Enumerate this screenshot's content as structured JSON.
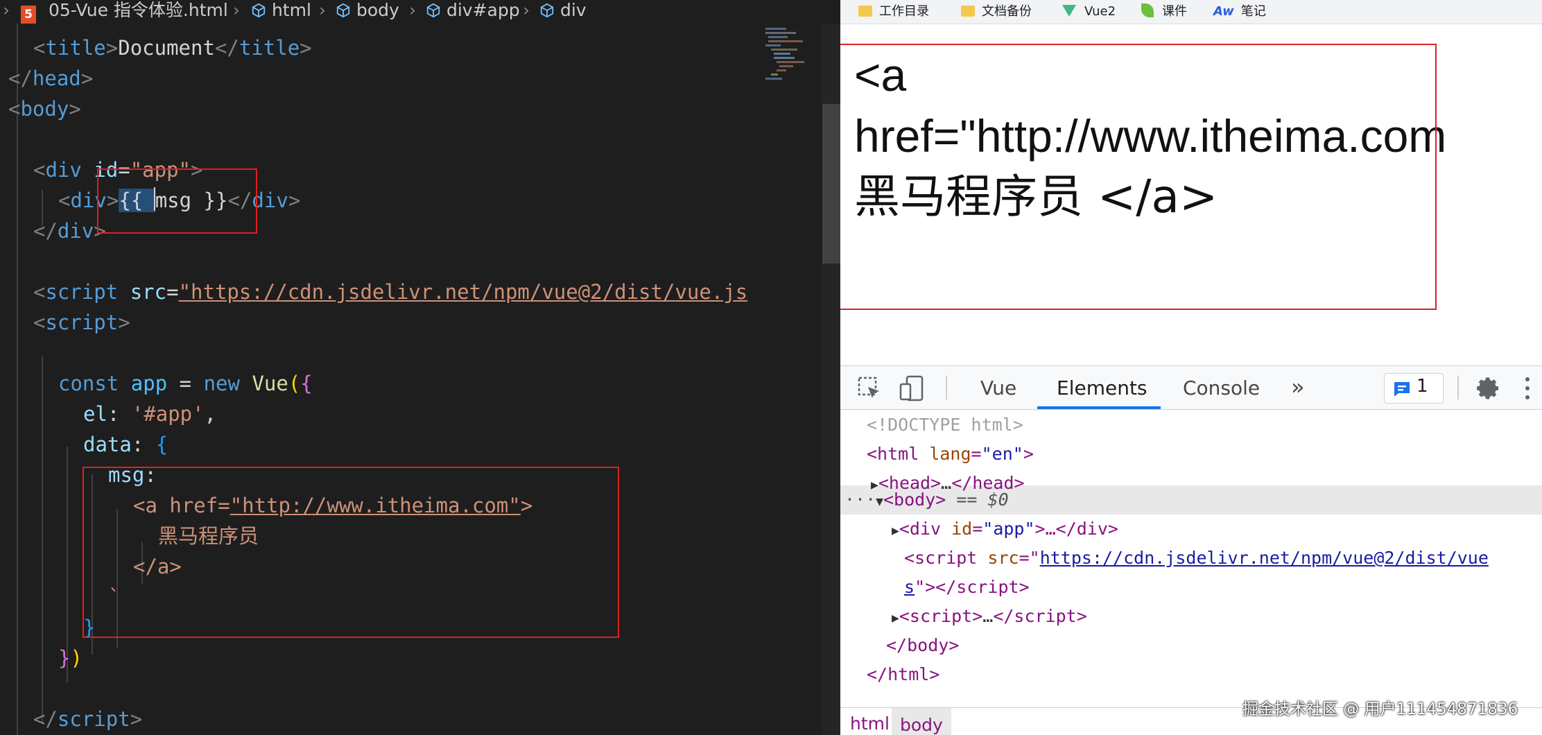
{
  "editor": {
    "breadcrumb": {
      "file": "05-Vue 指令体验.html",
      "items": [
        "html",
        "body",
        "div#app",
        "div"
      ]
    },
    "code_lines": {
      "l0_text": "Document",
      "l1_tag": "head",
      "l2_tag": "body",
      "l4_attr_value": "\"app\"",
      "l5_msg": "msg",
      "l8_src": "\"https://cdn.jsdelivr.net/npm/vue@2/dist/vue.js",
      "l11_const": "const",
      "l11_app": "app",
      "l11_new": "new",
      "l11_vue": "Vue",
      "l12_el": "el",
      "l12_val": "'#app'",
      "l13_data": "data",
      "l14_msg": "msg",
      "l15_href": "\"http://www.itheima.com\"",
      "l16_text": "黑马程序员",
      "l17_close": "</a>",
      "l18_tick": "`"
    }
  },
  "browser": {
    "bookmarks": [
      {
        "icon": "folder-icon",
        "label": "工作目录"
      },
      {
        "icon": "folder-icon",
        "label": "文档备份"
      },
      {
        "icon": "vue-logo-icon",
        "label": "Vue2"
      },
      {
        "icon": "leaf-icon",
        "label": "课件"
      },
      {
        "icon": "aw-logo-icon",
        "label": "笔记"
      }
    ],
    "page": {
      "line1": "<a",
      "line2": "href=\"http://www.itheima.com",
      "line3": "黑马程序员 </a>"
    },
    "devtools": {
      "tabs": [
        "Vue",
        "Elements",
        "Console"
      ],
      "active_tab": "Elements",
      "more": "»",
      "issues_count": "1",
      "dom": {
        "doctype": "<!DOCTYPE html>",
        "html_lang": "\"en\"",
        "head_collapsed": "…",
        "body_eq": "== $0",
        "div_id": "\"app\"",
        "script_src_line1": "https://cdn.jsdelivr.net/npm/vue@2/dist/vue",
        "script_src_line2": "s",
        "script_collapsed": "…"
      },
      "crumbs": [
        "html",
        "body"
      ]
    }
  },
  "watermark": "掘金技术社区 @ 用户111454871836",
  "colors": {
    "highlight_box": "#e0201f",
    "editor_bg": "#1e1e1e",
    "devtools_accent": "#1a73e8"
  }
}
